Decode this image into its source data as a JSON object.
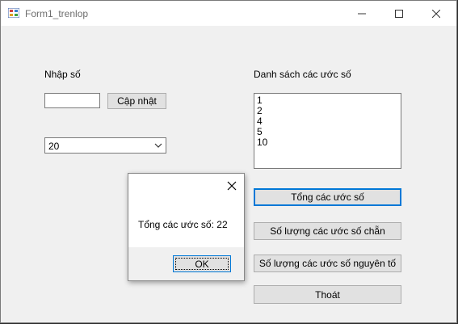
{
  "window": {
    "title": "Form1_trenlop"
  },
  "form": {
    "input_label": "Nhập số",
    "input_value": "",
    "update_button": "Cập nhật",
    "combo_value": "20",
    "list_label": "Danh sách các ước số",
    "divisors": [
      "1",
      "2",
      "4",
      "5",
      "10"
    ],
    "sum_button": "Tổng các ước số",
    "even_count_button": "Số lượng các ước số chẵn",
    "prime_count_button": "Số lượng các ước số nguyên tố",
    "exit_button": "Thoát"
  },
  "dialog": {
    "message": "Tổng các ước số: 22",
    "ok_button": "OK"
  },
  "icons": {
    "app": "form-app-icon",
    "minimize": "minimize-icon",
    "maximize": "maximize-icon",
    "close": "close-icon",
    "dropdown": "chevron-down-icon",
    "dialog_close": "close-icon"
  },
  "colors": {
    "focus": "#0078d7",
    "window_bg": "#f0f0f0",
    "button_bg": "#e1e1e1"
  }
}
